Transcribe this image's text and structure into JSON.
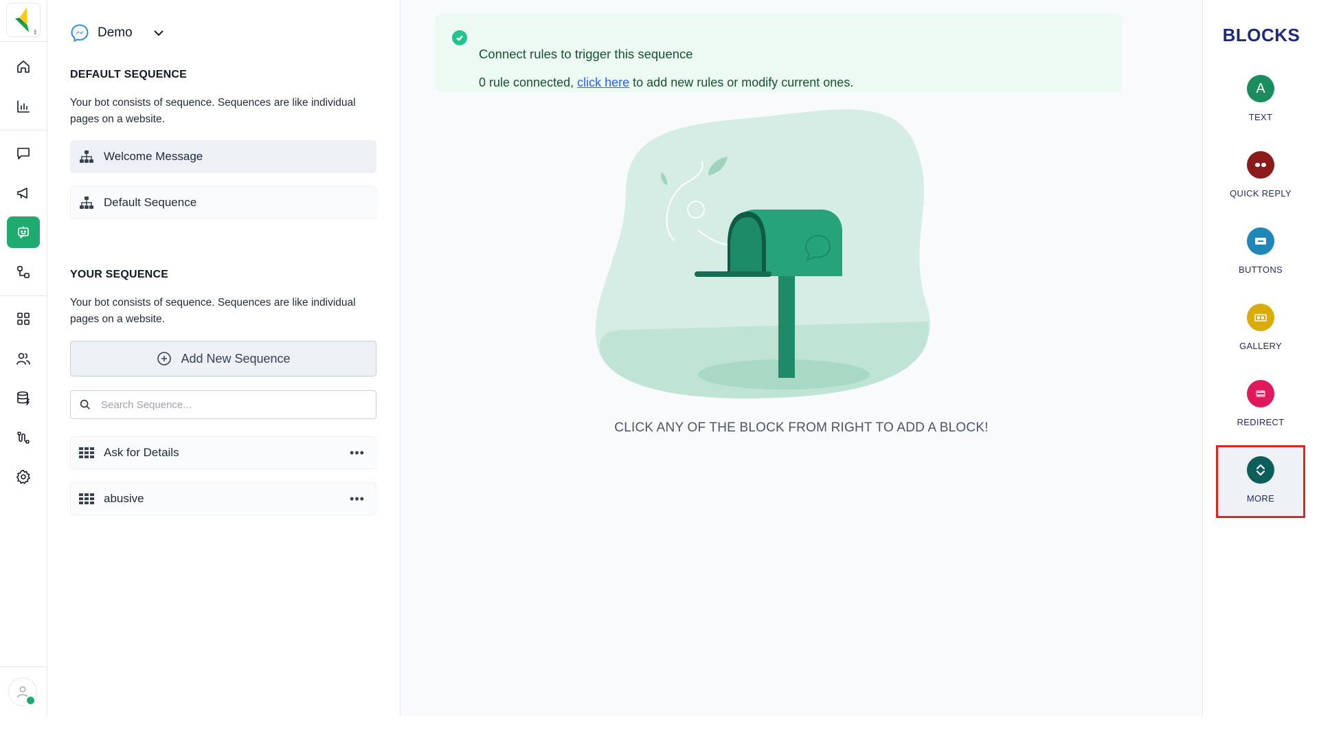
{
  "bot": {
    "name": "Demo"
  },
  "sidebar": {
    "items": [
      {
        "name": "home",
        "icon": "home-icon"
      },
      {
        "name": "analytics",
        "icon": "bar-chart-icon"
      },
      {
        "name": "inbox",
        "icon": "chat-bubble-icon"
      },
      {
        "name": "broadcast",
        "icon": "megaphone-icon"
      },
      {
        "name": "bot-builder",
        "icon": "bot-icon",
        "active": true
      },
      {
        "name": "integrations",
        "icon": "workflow-icon"
      },
      {
        "name": "apps",
        "icon": "grid-icon"
      },
      {
        "name": "audience",
        "icon": "users-icon"
      },
      {
        "name": "data-lab",
        "icon": "database-icon"
      },
      {
        "name": "automation",
        "icon": "flow-icon"
      },
      {
        "name": "settings",
        "icon": "gear-icon"
      }
    ]
  },
  "default_sequence": {
    "title": "DEFAULT SEQUENCE",
    "description": "Your bot consists of sequence. Sequences are like individual pages on a website.",
    "items": [
      {
        "label": "Welcome Message",
        "selected": true
      },
      {
        "label": "Default Sequence",
        "selected": false
      }
    ]
  },
  "your_sequence": {
    "title": "YOUR SEQUENCE",
    "description": "Your bot consists of sequence. Sequences are like individual pages on a website.",
    "add_label": "Add New Sequence",
    "search_placeholder": "Search Sequence...",
    "items": [
      {
        "label": "Ask for Details"
      },
      {
        "label": "abusive"
      }
    ],
    "more_label": "•••"
  },
  "banner": {
    "title": "Connect rules to trigger this sequence",
    "sub_prefix": "0 rule connected,",
    "link": "click here",
    "sub_suffix": "to add new rules or modify current ones."
  },
  "canvas": {
    "hint": "CLICK ANY OF THE BLOCK FROM RIGHT TO ADD A BLOCK!"
  },
  "blocks_panel": {
    "title": "BLOCKS",
    "items": [
      {
        "label": "TEXT",
        "glyph": "A",
        "color": "#1a8d5f",
        "icon": "letter-a-icon"
      },
      {
        "label": "QUICK REPLY",
        "color": "#8b1a1a",
        "icon": "quick-reply-icon"
      },
      {
        "label": "BUTTONS",
        "color": "#1f86b8",
        "icon": "button-icon"
      },
      {
        "label": "GALLERY",
        "color": "#d9ab0b",
        "icon": "gallery-icon"
      },
      {
        "label": "REDIRECT",
        "color": "#e0195c",
        "icon": "redirect-icon"
      },
      {
        "label": "MORE",
        "color": "#0b5e5a",
        "icon": "chevron-up-down-icon",
        "highlighted": true
      }
    ]
  },
  "colors": {
    "accent": "#1faa70",
    "blocks_title": "#1e2a78",
    "banner_bg": "#ecfaf3",
    "highlight": "#dc2626"
  }
}
